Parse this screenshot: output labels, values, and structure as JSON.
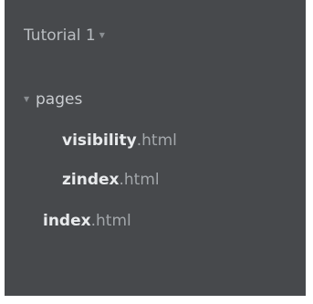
{
  "project": {
    "title": "Tutorial 1",
    "caret_icon": "caret-down-icon"
  },
  "tree": {
    "folder": {
      "label": "pages",
      "expanded_icon": "triangle-down-icon"
    },
    "folder_files": [
      {
        "name": "visibility",
        "ext": ".html"
      },
      {
        "name": "zindex",
        "ext": ".html"
      }
    ],
    "root_files": [
      {
        "name": "index",
        "ext": ".html"
      }
    ]
  },
  "colors": {
    "sidebar_bg": "#47494c",
    "file_name": "#e8eaec",
    "file_ext": "#a3a7ab"
  }
}
